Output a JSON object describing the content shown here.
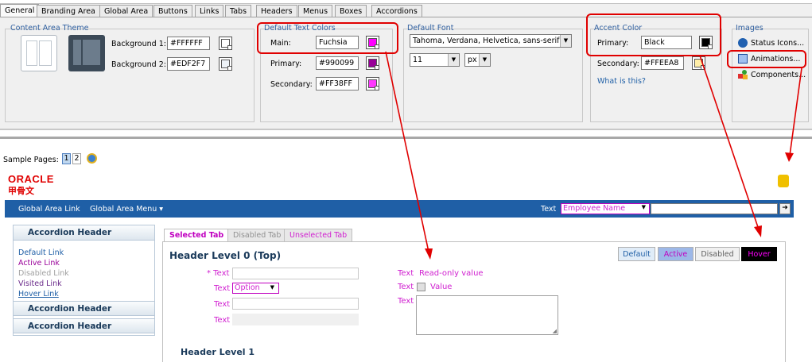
{
  "tabs": [
    "General",
    "Branding Area",
    "Global Area",
    "Buttons",
    "Links",
    "Tabs",
    "Headers",
    "Menus",
    "Boxes",
    "Accordions"
  ],
  "content_area_theme": {
    "title": "Content Area Theme",
    "bg1_label": "Background 1:",
    "bg1_value": "#FFFFFF",
    "bg2_label": "Background 2:",
    "bg2_value": "#EDF2F7"
  },
  "text_colors": {
    "title": "Default Text Colors",
    "main_label": "Main:",
    "main_value": "Fuchsia",
    "main_color": "#ff00ff",
    "primary_label": "Primary:",
    "primary_value": "#990099",
    "primary_color": "#990099",
    "secondary_label": "Secondary:",
    "secondary_value": "#FF38FF",
    "secondary_color": "#ff38ff"
  },
  "font": {
    "title": "Default Font",
    "family": "Tahoma, Verdana, Helvetica, sans-serif",
    "size": "11",
    "unit": "px"
  },
  "accent": {
    "title": "Accent Color",
    "primary_label": "Primary:",
    "primary_value": "Black",
    "primary_color": "#000000",
    "secondary_label": "Secondary:",
    "secondary_value": "#FFEEA8",
    "secondary_color": "#ffeea8",
    "help_link": "What is this?"
  },
  "images": {
    "title": "Images",
    "status": "Status Icons...",
    "animations": "Animations...",
    "components": "Components..."
  },
  "sample": {
    "label": "Sample Pages:",
    "page1": "1",
    "page2": "2"
  },
  "preview": {
    "logo_line1": "ORACLE",
    "logo_line2": "甲骨文",
    "nav_link": "Global Area Link",
    "nav_menu": "Global Area Menu ▾",
    "nav_text": "Text",
    "nav_select": "Employee Name",
    "acc_header1": "Accordion Header",
    "acc_header2": "Accordion Header",
    "acc_header3": "Accordion Header",
    "links": {
      "default": "Default Link",
      "active": "Active Link",
      "disabled": "Disabled Link",
      "visited": "Visited Link",
      "hover": "Hover Link"
    },
    "ptabs": {
      "selected": "Selected Tab",
      "disabled": "Disabled Tab",
      "unselected": "Unselected Tab"
    },
    "header0": "Header Level 0 (Top)",
    "header1": "Header Level 1",
    "buttons": {
      "default": "Default",
      "active": "Active",
      "disabled": "Disabled",
      "hover": "Hover"
    },
    "form": {
      "req_label": "* Text",
      "text_label": "Text",
      "option": "Option",
      "readonly_label": "Text",
      "readonly_value": "Read-only value",
      "check_label": "Text",
      "check_value": "Value",
      "area_label": "Text"
    }
  }
}
